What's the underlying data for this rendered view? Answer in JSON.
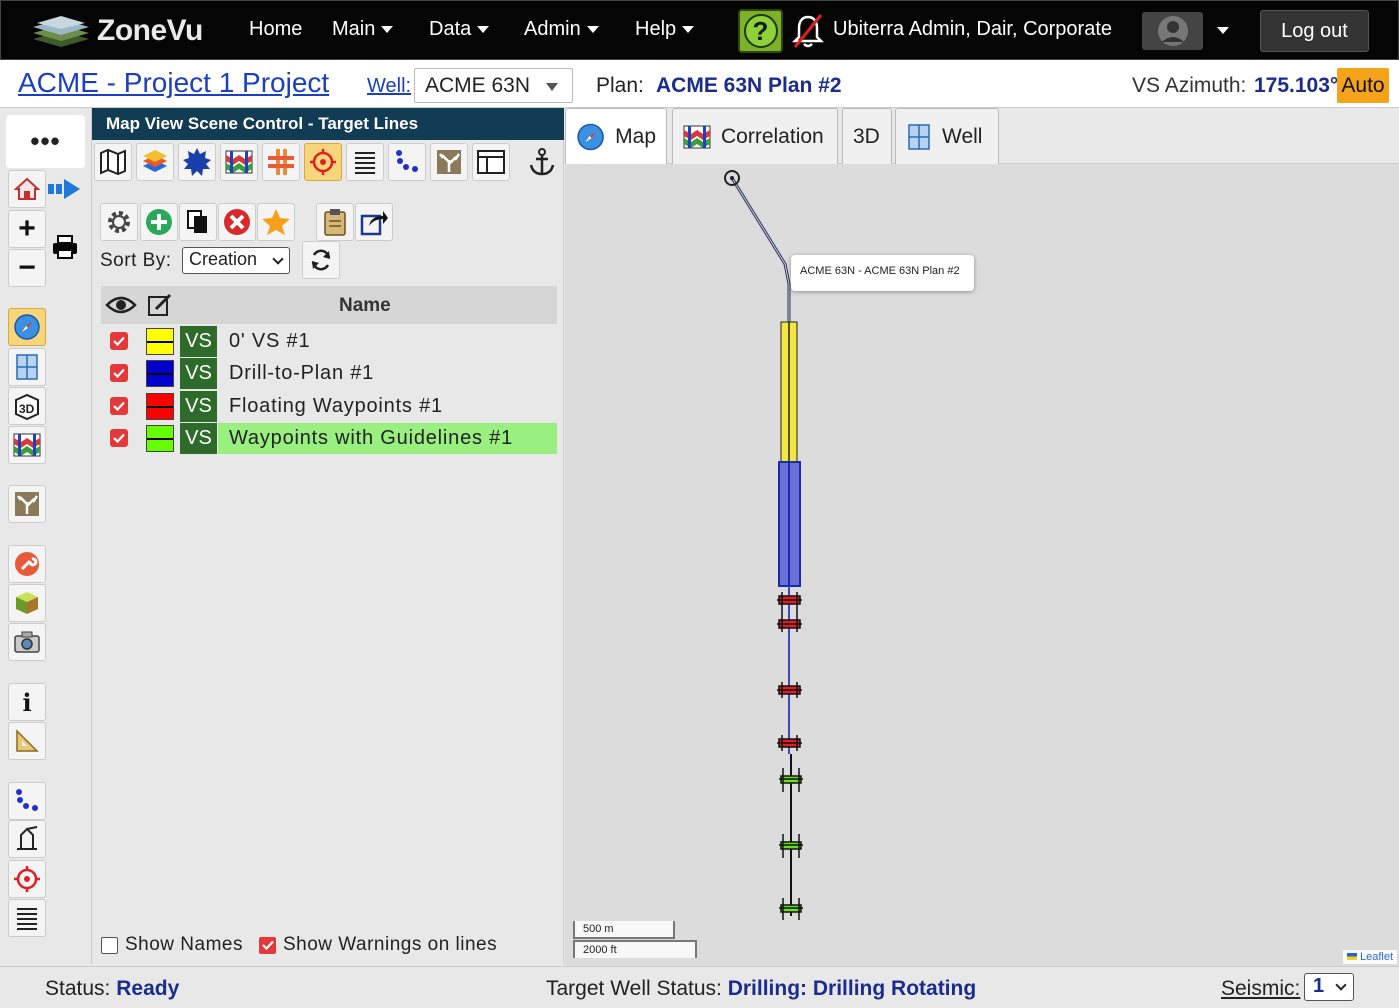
{
  "app": {
    "logo_text": "ZoneVu"
  },
  "nav": {
    "items": [
      {
        "label": "Home",
        "has_menu": false
      },
      {
        "label": "Main",
        "has_menu": true
      },
      {
        "label": "Data",
        "has_menu": true
      },
      {
        "label": "Admin",
        "has_menu": true
      },
      {
        "label": "Help",
        "has_menu": true
      }
    ],
    "help_icon": "?",
    "notifications_icon": "bell-off-icon",
    "user_name": "Ubiterra Admin, Dair, Corporate",
    "logout_label": "Log out"
  },
  "project": {
    "title": "ACME - Project 1 Project",
    "well_label": "Well:",
    "well_value": "ACME 63N",
    "plan_label": "Plan:",
    "plan_value": "ACME 63N Plan #2",
    "vs_label": "VS Azimuth:",
    "vs_value": "175.103°",
    "auto_label": "Auto"
  },
  "left_toolbar": {
    "more_label": "•••",
    "tools": [
      "home-icon",
      "forward-arrow-icon",
      "zoom-in-icon",
      "print-icon",
      "zoom-out-icon",
      "compass-icon",
      "well-grid-icon",
      "3d-icon",
      "correlation-icon",
      "tree-icon",
      "wrench-icon",
      "cube-icon",
      "camera-icon",
      "info-icon",
      "ruler-icon",
      "dots-path-icon",
      "marker-icon",
      "target-icon",
      "lines-icon"
    ]
  },
  "panel": {
    "title": "Map View Scene Control - Target Lines",
    "sort_label": "Sort By:",
    "sort_value": "Creation",
    "column_name": "Name",
    "rows": [
      {
        "label": "0' VS #1",
        "badge": "VS",
        "color": "#ffff00",
        "checked": true,
        "highlight": false
      },
      {
        "label": "Drill-to-Plan #1",
        "badge": "VS",
        "color": "#0000cc",
        "checked": true,
        "highlight": false
      },
      {
        "label": "Floating Waypoints #1",
        "badge": "VS",
        "color": "#ff0000",
        "checked": true,
        "highlight": false
      },
      {
        "label": "Waypoints with Guidelines #1",
        "badge": "VS",
        "color": "#66ff00",
        "checked": true,
        "highlight": true
      }
    ],
    "show_names_label": "Show Names",
    "show_names_checked": false,
    "show_warnings_label": "Show Warnings on lines",
    "show_warnings_checked": true
  },
  "tabs": [
    {
      "label": "Map",
      "active": true
    },
    {
      "label": "Correlation",
      "active": false
    },
    {
      "label": "3D",
      "active": false
    },
    {
      "label": "Well",
      "active": false
    }
  ],
  "map": {
    "tooltip": "ACME 63N - ACME 63N Plan #2",
    "scale_metric": "500 m",
    "scale_imperial": "2000 ft",
    "attribution": "Leaflet"
  },
  "status": {
    "status_label": "Status:",
    "status_value": "Ready",
    "target_label": "Target Well Status:",
    "target_value": "Drilling: Drilling Rotating",
    "seismic_label": "Seismic:",
    "seismic_value": "1"
  },
  "colors": {
    "accent_blue": "#1a2c8e",
    "link_blue": "#1a3fbf",
    "panel_header": "#123b54",
    "vs_badge": "#2e6b2a",
    "highlight_row": "#99ef80",
    "auto_orange": "#f5a31a"
  }
}
